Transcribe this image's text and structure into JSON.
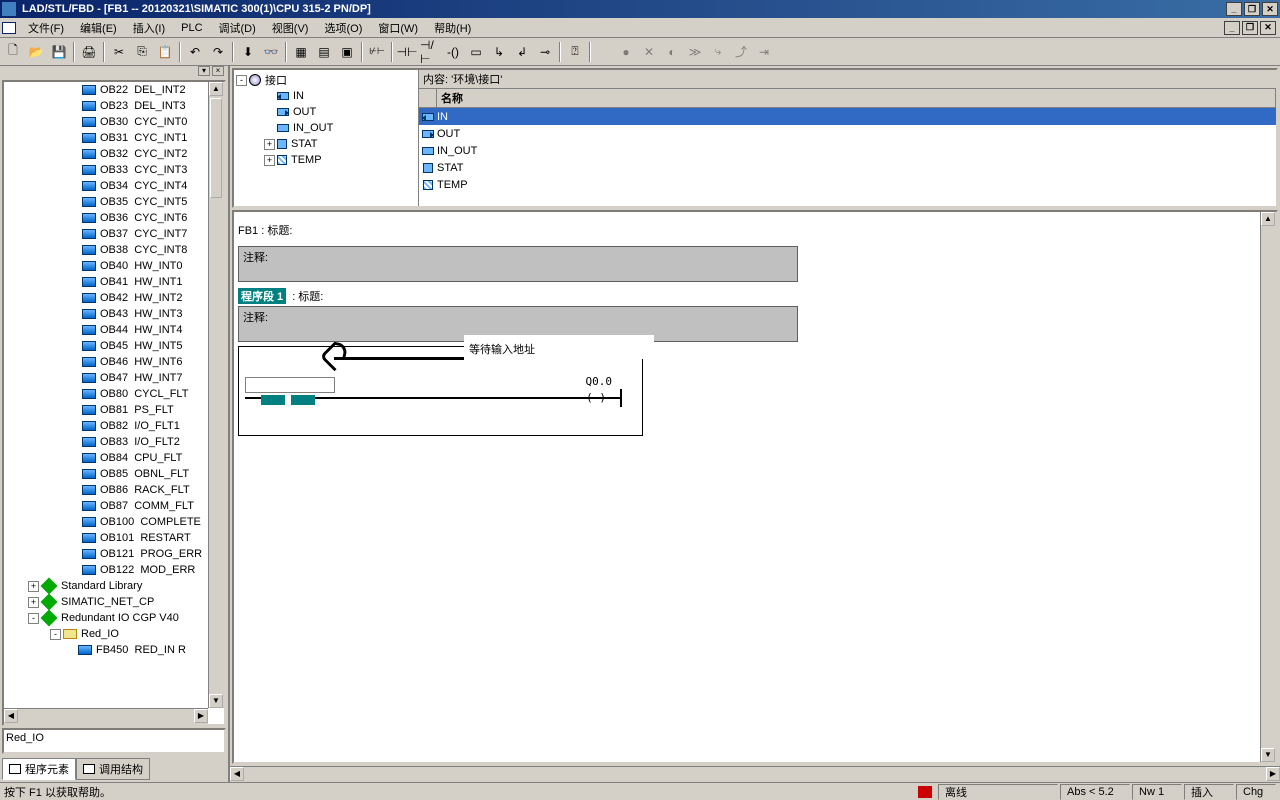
{
  "title": "LAD/STL/FBD  - [FB1 -- 20120321\\SIMATIC 300(1)\\CPU 315-2 PN/DP]",
  "menu": {
    "file": "文件(F)",
    "edit": "编辑(E)",
    "insert": "插入(I)",
    "plc": "PLC",
    "debug": "调试(D)",
    "view": "视图(V)",
    "options": "选项(O)",
    "window": "窗口(W)",
    "help": "帮助(H)"
  },
  "tree": {
    "blocks": [
      {
        "id": "OB22",
        "name": "DEL_INT2"
      },
      {
        "id": "OB23",
        "name": "DEL_INT3"
      },
      {
        "id": "OB30",
        "name": "CYC_INT0"
      },
      {
        "id": "OB31",
        "name": "CYC_INT1"
      },
      {
        "id": "OB32",
        "name": "CYC_INT2"
      },
      {
        "id": "OB33",
        "name": "CYC_INT3"
      },
      {
        "id": "OB34",
        "name": "CYC_INT4"
      },
      {
        "id": "OB35",
        "name": "CYC_INT5"
      },
      {
        "id": "OB36",
        "name": "CYC_INT6"
      },
      {
        "id": "OB37",
        "name": "CYC_INT7"
      },
      {
        "id": "OB38",
        "name": "CYC_INT8"
      },
      {
        "id": "OB40",
        "name": "HW_INT0"
      },
      {
        "id": "OB41",
        "name": "HW_INT1"
      },
      {
        "id": "OB42",
        "name": "HW_INT2"
      },
      {
        "id": "OB43",
        "name": "HW_INT3"
      },
      {
        "id": "OB44",
        "name": "HW_INT4"
      },
      {
        "id": "OB45",
        "name": "HW_INT5"
      },
      {
        "id": "OB46",
        "name": "HW_INT6"
      },
      {
        "id": "OB47",
        "name": "HW_INT7"
      },
      {
        "id": "OB80",
        "name": "CYCL_FLT"
      },
      {
        "id": "OB81",
        "name": "PS_FLT"
      },
      {
        "id": "OB82",
        "name": "I/O_FLT1"
      },
      {
        "id": "OB83",
        "name": "I/O_FLT2"
      },
      {
        "id": "OB84",
        "name": "CPU_FLT"
      },
      {
        "id": "OB85",
        "name": "OBNL_FLT"
      },
      {
        "id": "OB86",
        "name": "RACK_FLT"
      },
      {
        "id": "OB87",
        "name": "COMM_FLT"
      },
      {
        "id": "OB100",
        "name": "COMPLETE"
      },
      {
        "id": "OB101",
        "name": "RESTART"
      },
      {
        "id": "OB121",
        "name": "PROG_ERR"
      },
      {
        "id": "OB122",
        "name": "MOD_ERR"
      }
    ],
    "libs": [
      {
        "name": "Standard Library",
        "expander": "+"
      },
      {
        "name": "SIMATIC_NET_CP",
        "expander": "+"
      },
      {
        "name": "Redundant IO CGP V40",
        "expander": "-"
      }
    ],
    "redio": "Red_IO",
    "fb450": {
      "id": "FB450",
      "name": "RED_IN  R"
    }
  },
  "bottom_info": "Red_IO",
  "left_tabs": {
    "elements": "程序元素",
    "callstruct": "调用结构"
  },
  "interface": {
    "root": "接口",
    "items": [
      "IN",
      "OUT",
      "IN_OUT",
      "STAT",
      "TEMP"
    ]
  },
  "content_header": "内容:   '环境\\接口'",
  "table": {
    "name_header": "名称",
    "rows": [
      "IN",
      "OUT",
      "IN_OUT",
      "STAT",
      "TEMP"
    ]
  },
  "editor": {
    "fb_title": "FB1 : 标题:",
    "comment_label": "注释:",
    "network_label": "程序段 1",
    "network_title": ": 标题:",
    "hint": "等待输入地址",
    "output": "Q0.0",
    "coil": "( )"
  },
  "status": {
    "help": "按下 F1 以获取帮助。",
    "offline": "离线",
    "abs": "Abs < 5.2",
    "nw": "Nw 1",
    "insert": "插入",
    "chg": "Chg"
  }
}
